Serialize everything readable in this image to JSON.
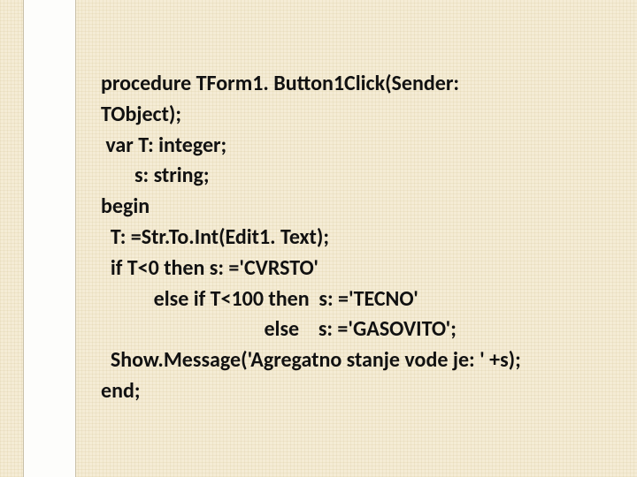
{
  "code": {
    "lines": [
      "procedure TForm1. Button1Click(Sender:",
      "TObject);",
      " var T: integer;",
      "       s: string;",
      "begin",
      "  T: =Str.To.Int(Edit1. Text);",
      "  if T<0 then s: ='CVRSTO'",
      "           else if T<100 then  s: ='TECNO'",
      "                                  else    s: ='GASOVITO';",
      "  Show.Message('Agregatno stanje vode je: ' +s);",
      "end;"
    ]
  }
}
